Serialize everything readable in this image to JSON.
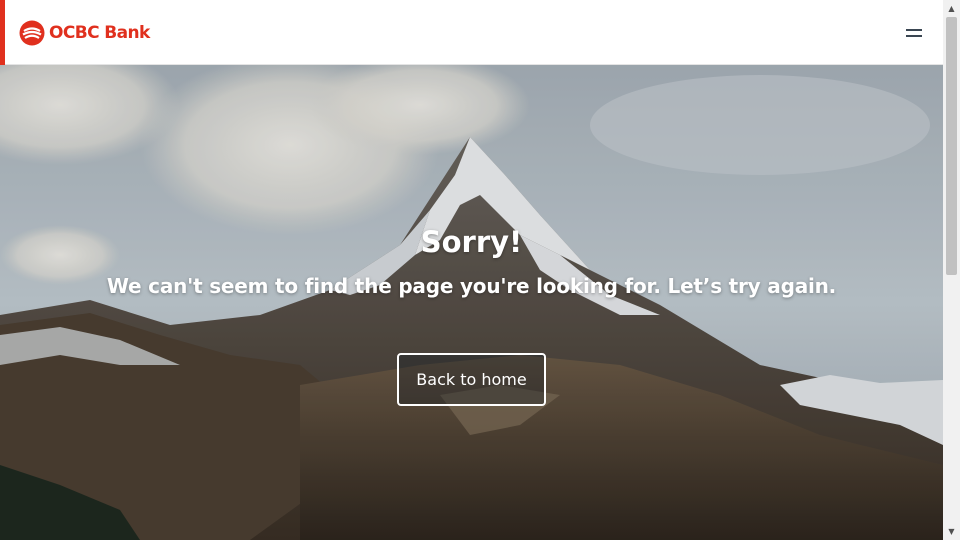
{
  "header": {
    "logo_text": "OCBC Bank",
    "brand_color": "#e0301e",
    "menu_icon": "hamburger-menu-icon"
  },
  "hero": {
    "title": "Sorry!",
    "subtitle": "We can't seem to find the page you're looking for. Let’s try again.",
    "button_label": "Back to home",
    "background": "mountain-peak-photo"
  },
  "scrollbar": {
    "up_icon": "scroll-up-arrow-icon",
    "down_icon": "scroll-down-arrow-icon"
  }
}
